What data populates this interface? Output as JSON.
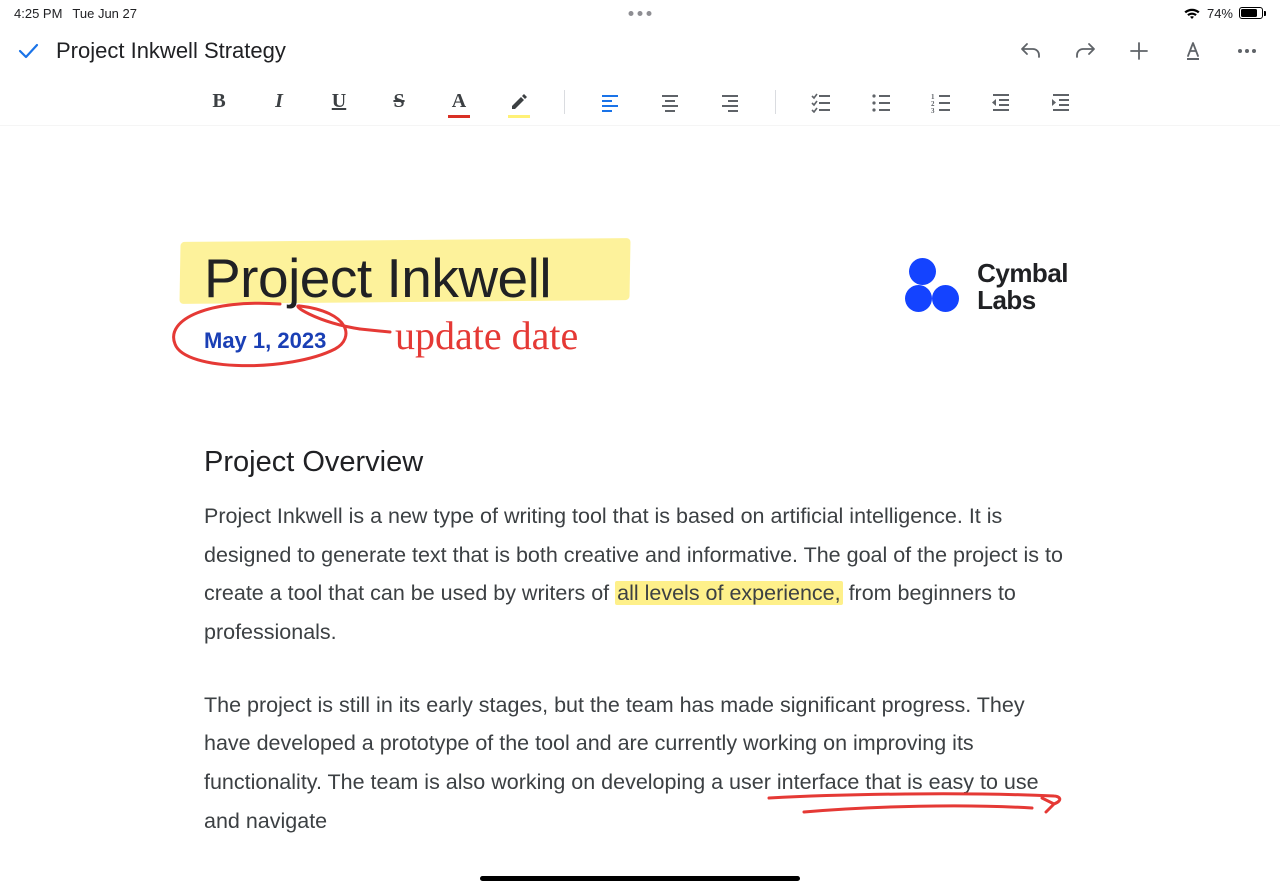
{
  "status": {
    "time": "4:25 PM",
    "date": "Tue Jun 27",
    "battery_pct": "74%"
  },
  "header": {
    "title": "Project Inkwell Strategy"
  },
  "toolbar": {
    "bold": "B",
    "italic": "I",
    "underline": "U",
    "strike": "S",
    "textcolor": "A"
  },
  "document": {
    "title": "Project Inkwell",
    "date": "May 1, 2023",
    "annotation_update_date": "update date",
    "logo_name": "Cymbal",
    "logo_sub": "Labs",
    "section_heading": "Project Overview",
    "p1_a": "Project Inkwell is a new type of writing tool that is based on artificial intelligence. It is designed to generate text that is both creative and informative. The goal of the project is to create a tool that can be used by writers of ",
    "p1_hl": "all levels of experience,",
    "p1_b": " from beginners to professionals.",
    "p2": "The project is still in its early stages, but the team has made significant progress. They have developed a prototype of the tool and are currently working on improving its functionality. The team is also working on developing a user interface that is easy to use and navigate"
  }
}
